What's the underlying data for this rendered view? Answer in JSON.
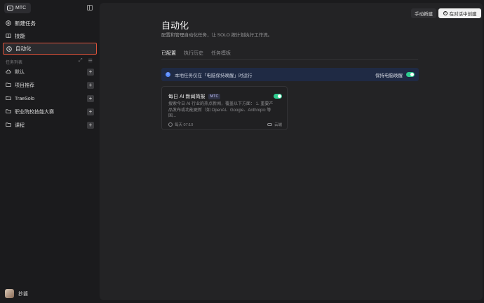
{
  "app": {
    "brand": "MTC"
  },
  "sidebar": {
    "nav": [
      {
        "label": "新建任务",
        "icon": "plus-circle-icon"
      },
      {
        "label": "技能",
        "icon": "book-icon"
      },
      {
        "label": "自动化",
        "icon": "clock-icon"
      }
    ],
    "section_title": "任务列表",
    "folders": [
      {
        "label": "默认",
        "icon": "cloud-icon"
      },
      {
        "label": "项目推荐",
        "icon": "folder-icon"
      },
      {
        "label": "TraeSolo",
        "icon": "folder-icon"
      },
      {
        "label": "职业院校技能大赛",
        "icon": "folder-icon"
      },
      {
        "label": "课程",
        "icon": "folder-icon"
      }
    ],
    "user_name": "抄酱"
  },
  "header": {
    "manual_button": "手动新建",
    "create_button": "在对话中创建"
  },
  "main": {
    "title": "自动化",
    "subtitle": "配置和管理自动化任务，让 SOLO 按计划执行工作流。",
    "tabs": [
      "已配置",
      "执行历史",
      "任务模板"
    ],
    "notice": "本地任务仅在「电脑保持唤醒」时运行",
    "keep_awake_label": "保持电脑唤醒",
    "card": {
      "title": "每日 AI 新闻简报",
      "tag": "MTC",
      "desc": "搜索今日 AI 行业的热点新闻，覆盖以下方面： 1. 重要产品发布或功能更新（如 OpenAI、Google、Anthropic 等国...",
      "schedule": "每天 07:10",
      "location": "云端"
    }
  },
  "colors": {
    "accent_toggle": "#2ecc8f",
    "highlight_border": "#e0533a",
    "notice_bg": "#1f2a44"
  }
}
